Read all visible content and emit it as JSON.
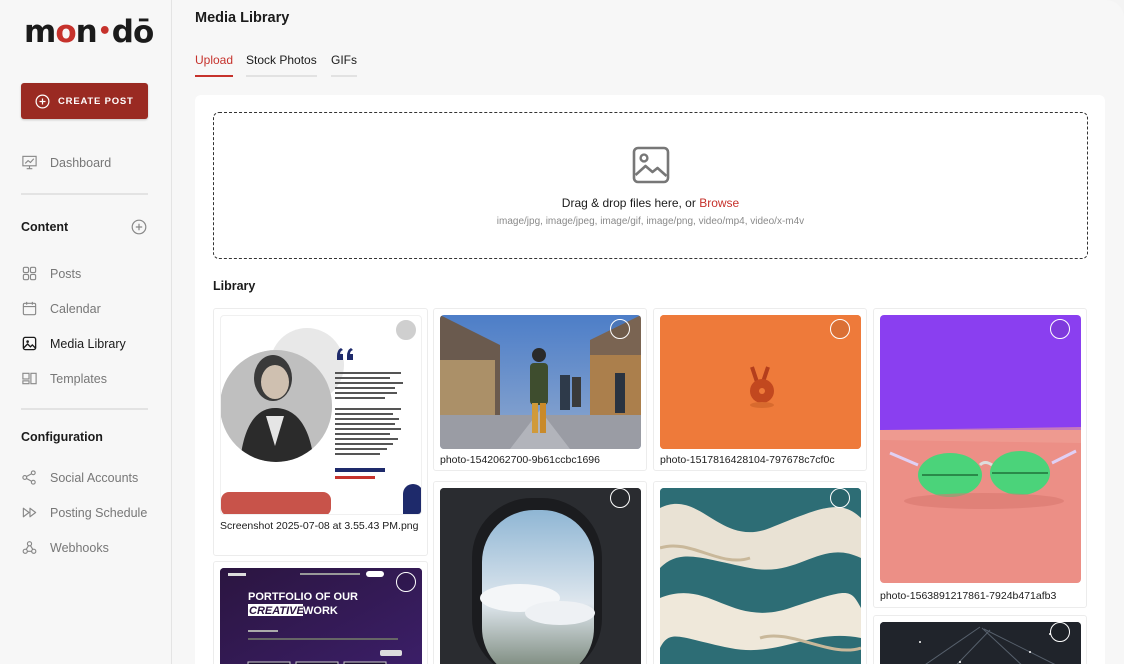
{
  "brand": {
    "logo_part1": "m",
    "logo_o1": "o",
    "logo_part2": "n",
    "logo_dot": "•",
    "logo_part3": "d",
    "logo_o2": "ō",
    "accent": "#c6322c"
  },
  "sidebar": {
    "create_label": "CREATE POST",
    "dashboard": "Dashboard",
    "content_title": "Content",
    "posts": "Posts",
    "calendar": "Calendar",
    "media_library": "Media Library",
    "templates": "Templates",
    "configuration_title": "Configuration",
    "social_accounts": "Social Accounts",
    "posting_schedule": "Posting Schedule",
    "webhooks": "Webhooks"
  },
  "main": {
    "title": "Media Library",
    "tabs": [
      "Upload",
      "Stock Photos",
      "GIFs"
    ],
    "dropzone": {
      "text": "Drag & drop files here, or ",
      "browse": "Browse",
      "types": "image/jpg, image/jpeg, image/gif, image/png, video/mp4, video/x-m4v"
    },
    "library_title": "Library",
    "items": [
      {
        "caption": "Screenshot 2025-07-08 at 3.55.43 PM.png"
      },
      {
        "caption": "photo-1542062700-9b61ccbc1696"
      },
      {
        "caption": "photo-1517816428104-797678c7cf0c"
      },
      {
        "caption": "photo-1563891217861-7924b471afb3"
      }
    ],
    "screenshot_card": {
      "quote_text": "Lorem ipsum dolor sit amet, consectetur adipiscing elit. Fusce lacus nisl, luctus ut viverra quis, gravida pellentesque nunc.",
      "quote_text2": "Fusce imperdiet nibh sed libero tristique, at faucibus velit interdum. Aenean consectetur sollicitudin mauris, non ultricies ante gravida fringilla. Integer bibendum eros id viverra placerat.",
      "name": "Larissa Grant",
      "role": "Brand Manager"
    },
    "portfolio_card": {
      "line1": "PORTFOLIO OF OUR",
      "line2a": "CREATIVE",
      "line2b": " WORK",
      "nav_brand": "mon•dō"
    }
  }
}
